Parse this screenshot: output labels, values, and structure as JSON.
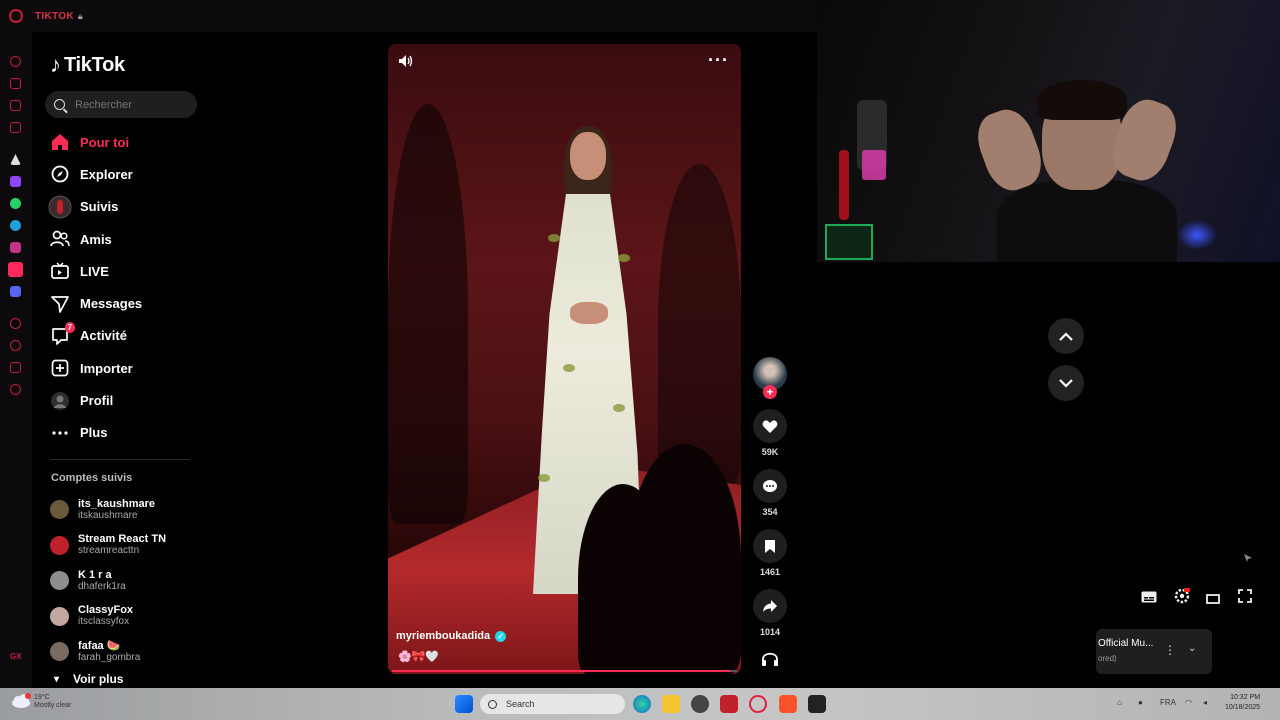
{
  "window": {
    "title": "TIKTOK"
  },
  "app": {
    "name": "TikTok"
  },
  "search": {
    "placeholder": "Rechercher"
  },
  "nav": [
    {
      "label": "Pour toi",
      "icon": "home-icon",
      "active": true
    },
    {
      "label": "Explorer",
      "icon": "compass-icon"
    },
    {
      "label": "Suivis",
      "icon": "following-avatar-icon"
    },
    {
      "label": "Amis",
      "icon": "friends-icon"
    },
    {
      "label": "LIVE",
      "icon": "live-icon"
    },
    {
      "label": "Messages",
      "icon": "messages-icon"
    },
    {
      "label": "Activité",
      "icon": "activity-icon",
      "badge": "7"
    },
    {
      "label": "Importer",
      "icon": "upload-icon"
    },
    {
      "label": "Profil",
      "icon": "profile-icon"
    },
    {
      "label": "Plus",
      "icon": "more-dots-icon"
    }
  ],
  "followed": {
    "title": "Comptes suivis",
    "accounts": [
      {
        "name": "its_kaushmare",
        "handle": "itskaushmare",
        "color": "#6a5a3a"
      },
      {
        "name": "Stream React TN",
        "handle": "streamreacttn",
        "color": "#c0212b"
      },
      {
        "name": "K 1 r a",
        "handle": "dhaferk1ra",
        "color": "#8d8d8d"
      },
      {
        "name": "ClassyFox",
        "handle": "itsclassyfox",
        "color": "#c4a8a0"
      },
      {
        "name": "fafaa 🍉",
        "handle": "farah_gombra",
        "color": "#7a6a62"
      }
    ],
    "see_more": "Voir plus"
  },
  "video": {
    "author": "myriemboukadida",
    "caption_emojis": "🌸🎀🤍",
    "progress": 0.98
  },
  "actions": [
    {
      "name": "like",
      "icon": "heart-icon",
      "count": "59K"
    },
    {
      "name": "comment",
      "icon": "comment-icon",
      "count": "354"
    },
    {
      "name": "bookmark",
      "icon": "bookmark-icon",
      "count": "1461"
    },
    {
      "name": "share",
      "icon": "share-icon",
      "count": "1014"
    },
    {
      "name": "sound",
      "icon": "headphones-icon",
      "count": ""
    }
  ],
  "youtube_mini": {
    "title": "Official Mu...",
    "subtitle": "ored)"
  },
  "taskbar": {
    "search_label": "Search",
    "weather_line1": "19°C",
    "weather_line2": "Mostly clear",
    "lang": "FRA",
    "time": "10:32 PM",
    "date": "10/18/2025"
  },
  "opera": {
    "gx_label": "GX"
  },
  "colors": {
    "accent": "#fe2c55",
    "opera_red": "#c0213a",
    "verified": "#20d5ec"
  }
}
